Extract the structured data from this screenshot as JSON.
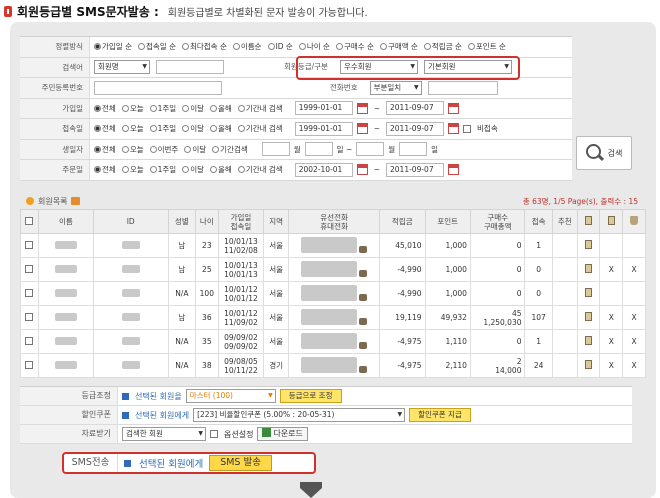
{
  "header": {
    "title": "회원등급별 SMS문자발송 :",
    "description": "회원등급별로 차별화된 문자 발송이 가능합니다."
  },
  "search": {
    "sort_label": "정렬방식",
    "sort_options": [
      "가입일 순",
      "접속일 순",
      "최다접속 순",
      "이름순",
      "ID 순",
      "나이 순",
      "구매수 순",
      "구매액 순",
      "적립금 순",
      "포인트 순"
    ],
    "keyword_label": "검색어",
    "keyword_select": "회원명",
    "grade_label": "회원등급/구분",
    "grade_select": "우수회원",
    "type_select": "기본회원",
    "resident_label": "주민등록번호",
    "phone_label": "전화번호",
    "phone_select": "부분일치",
    "join_label": "가입일",
    "access_label": "접속일",
    "birthday_label": "생일자",
    "order_label": "주문일",
    "period_options": [
      "전체",
      "오늘",
      "1주일",
      "이달",
      "올해",
      "기간내 검색"
    ],
    "birthday_options": [
      "전체",
      "오늘",
      "이번주",
      "이달",
      "기간검색"
    ],
    "join_from": "1999-01-01",
    "join_to": "2011-09-07",
    "access_from": "1999-01-01",
    "access_to": "2011-09-07",
    "no_access_label": "비접속",
    "month_unit": "월",
    "day_unit": "일",
    "day_tilde": "일 ~",
    "order_from": "2002-10-01",
    "order_to": "2011-09-07",
    "search_button": "검색"
  },
  "list": {
    "title": "회원목록",
    "totals": "총 63명, 1/5 Page(s), 출력수 : 15",
    "columns": [
      "이름",
      "ID",
      "성별",
      "나이",
      "가입일\n접속일",
      "지역",
      "유선전화\n휴대전화",
      "적립금",
      "포인트",
      "구매수\n구매총액",
      "접속",
      "추천"
    ],
    "rows": [
      {
        "gender": "남",
        "age": "23",
        "join": "10/01/13",
        "access": "11/02/08",
        "region": "서울",
        "reserve": "45,010",
        "point": "1,000",
        "purchases": "0",
        "total": "",
        "visits": "1",
        "mark1": "",
        "mark2": ""
      },
      {
        "gender": "남",
        "age": "25",
        "join": "10/01/13",
        "access": "10/01/13",
        "region": "서울",
        "reserve": "-4,990",
        "point": "1,000",
        "purchases": "0",
        "total": "",
        "visits": "0",
        "mark1": "X",
        "mark2": "X"
      },
      {
        "gender": "N/A",
        "age": "100",
        "join": "10/01/12",
        "access": "10/01/12",
        "region": "서울",
        "reserve": "-4,990",
        "point": "1,000",
        "purchases": "0",
        "total": "",
        "visits": "0",
        "mark1": "",
        "mark2": ""
      },
      {
        "gender": "남",
        "age": "36",
        "join": "10/01/12",
        "access": "11/09/02",
        "region": "서울",
        "reserve": "19,119",
        "point": "49,932",
        "purchases": "45",
        "total": "1,250,030",
        "visits": "107",
        "mark1": "X",
        "mark2": "X"
      },
      {
        "gender": "N/A",
        "age": "35",
        "join": "09/09/02",
        "access": "09/09/02",
        "region": "서울",
        "reserve": "-4,975",
        "point": "1,110",
        "purchases": "0",
        "total": "",
        "visits": "1",
        "mark1": "X",
        "mark2": "X"
      },
      {
        "gender": "N/A",
        "age": "38",
        "join": "09/08/05",
        "access": "10/11/22",
        "region": "경기",
        "reserve": "-4,975",
        "point": "2,110",
        "purchases": "2",
        "total": "14,000",
        "visits": "24",
        "mark1": "X",
        "mark2": "X"
      }
    ]
  },
  "actions": {
    "grade_label": "등급조정",
    "selected_members": "선택된 회원을",
    "grade_select": "마스터 (100)",
    "grade_button": "등급으로 조정",
    "coupon_label": "할인쿠폰",
    "selected_members_to": "선택된 회원에게",
    "coupon_select": "[223] 비율할인쿠폰 (5.00% : 20-05-31)",
    "coupon_button": "할인쿠폰 지급",
    "download_label": "자료받기",
    "download_select": "검색한 회원",
    "option_label": "옵션설정",
    "download_button": "다운로드",
    "sms_label": "SMS전송",
    "sms_to": "선택된 회원에게",
    "sms_button": "SMS 발송"
  }
}
